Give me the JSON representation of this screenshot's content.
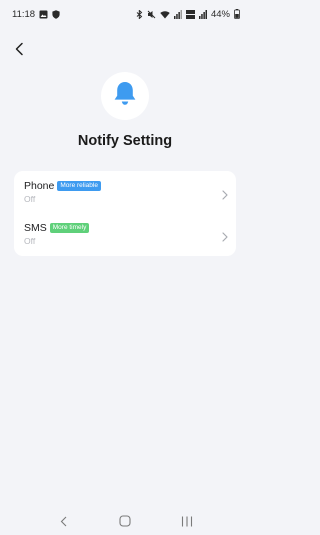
{
  "status_bar": {
    "time": "11:18",
    "battery": "44%",
    "icons": [
      "gallery-icon",
      "shield-icon",
      "bluetooth-icon",
      "mute-icon",
      "wifi-icon",
      "signal-icon",
      "volte-icon",
      "signal-icon",
      "battery-icon"
    ]
  },
  "header": {
    "back_icon": "chevron-left-icon"
  },
  "hero": {
    "icon": "bell-icon",
    "accent": "#3e9bf0",
    "title": "Notify Setting"
  },
  "settings": [
    {
      "label": "Phone",
      "badge": "More reliable",
      "badge_color": "#3e9bf0",
      "value": "Off"
    },
    {
      "label": "SMS",
      "badge": "More timely",
      "badge_color": "#5fd07a",
      "value": "Off"
    }
  ],
  "nav_bar": {
    "buttons": [
      "back-nav-icon",
      "home-nav-icon",
      "recents-nav-icon"
    ]
  }
}
